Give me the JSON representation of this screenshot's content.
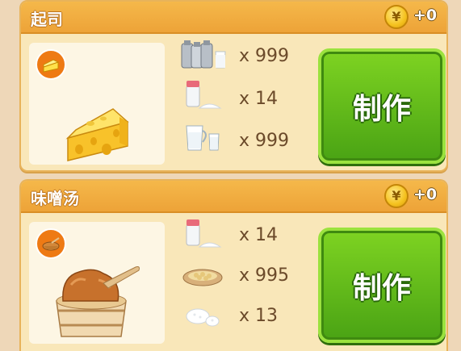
{
  "recipes": [
    {
      "name": "起司",
      "coin_symbol": "¥",
      "coin_reward": "+0",
      "dish_icon": "cheese-wedge-icon",
      "ingredients": [
        {
          "icon": "milk-cans-icon",
          "qty": "x 999"
        },
        {
          "icon": "salt-icon",
          "qty": "x 14"
        },
        {
          "icon": "milk-pitcher-icon",
          "qty": "x 999"
        }
      ],
      "make_label": "制作"
    },
    {
      "name": "味噌汤",
      "coin_symbol": "¥",
      "coin_reward": "+0",
      "dish_icon": "miso-tub-icon",
      "ingredients": [
        {
          "icon": "salt-icon",
          "qty": "x 14"
        },
        {
          "icon": "soybeans-icon",
          "qty": "x 995"
        },
        {
          "icon": "rice-icon",
          "qty": "x 13"
        }
      ],
      "make_label": "制作"
    }
  ],
  "colors": {
    "header": "#f0aa3c",
    "card": "#f9e7b9",
    "button": "#5fb81a",
    "badge": "#ee7a14"
  }
}
